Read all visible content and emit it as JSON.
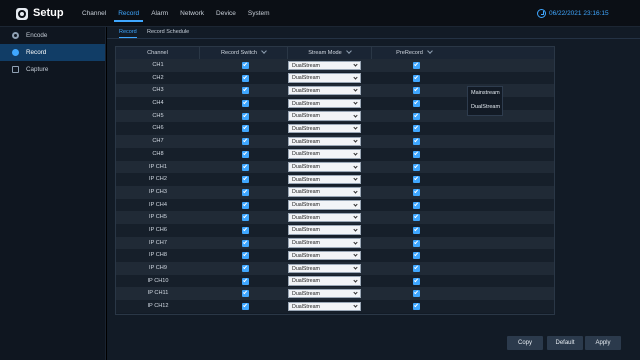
{
  "app": {
    "title": "Setup"
  },
  "menu": [
    "Channel",
    "Record",
    "Alarm",
    "Network",
    "Device",
    "System"
  ],
  "menu_active": "Record",
  "clock": "06/22/2021 23:16:15",
  "sidebar": {
    "items": [
      {
        "label": "Encode",
        "icon": "gear-icon"
      },
      {
        "label": "Record",
        "icon": "record-icon"
      },
      {
        "label": "Capture",
        "icon": "capture-icon"
      }
    ]
  },
  "tabs": [
    "Record",
    "Record Schedule"
  ],
  "table": {
    "headers": [
      "Channel",
      "Record Switch",
      "Stream Mode",
      "PreRecord"
    ],
    "rows": [
      {
        "channel": "CH1",
        "stream": "DualStream"
      },
      {
        "channel": "CH2",
        "stream": "DualStream"
      },
      {
        "channel": "CH3",
        "stream": "DualStream"
      },
      {
        "channel": "CH4",
        "stream": "DualStream"
      },
      {
        "channel": "CH5",
        "stream": "DualStream"
      },
      {
        "channel": "CH6",
        "stream": "DualStream"
      },
      {
        "channel": "CH7",
        "stream": "DualStream"
      },
      {
        "channel": "CH8",
        "stream": "DualStream"
      },
      {
        "channel": "IP CH1",
        "stream": "DualStream"
      },
      {
        "channel": "IP CH2",
        "stream": "DualStream"
      },
      {
        "channel": "IP CH3",
        "stream": "DualStream"
      },
      {
        "channel": "IP CH4",
        "stream": "DualStream"
      },
      {
        "channel": "IP CH5",
        "stream": "DualStream"
      },
      {
        "channel": "IP CH6",
        "stream": "DualStream"
      },
      {
        "channel": "IP CH7",
        "stream": "DualStream"
      },
      {
        "channel": "IP CH8",
        "stream": "DualStream"
      },
      {
        "channel": "IP CH9",
        "stream": "DualStream"
      },
      {
        "channel": "IP CH10",
        "stream": "DualStream"
      },
      {
        "channel": "IP CH11",
        "stream": "DualStream"
      },
      {
        "channel": "IP CH12",
        "stream": "DualStream"
      }
    ]
  },
  "dropdown": {
    "options": [
      "Mainstream",
      "DualStream"
    ]
  },
  "buttons": {
    "copy": "Copy",
    "default": "Default",
    "apply": "Apply"
  },
  "colors": {
    "accent": "#3fa7ff",
    "sidebar_active": "#113d66",
    "background": "#121b26"
  }
}
